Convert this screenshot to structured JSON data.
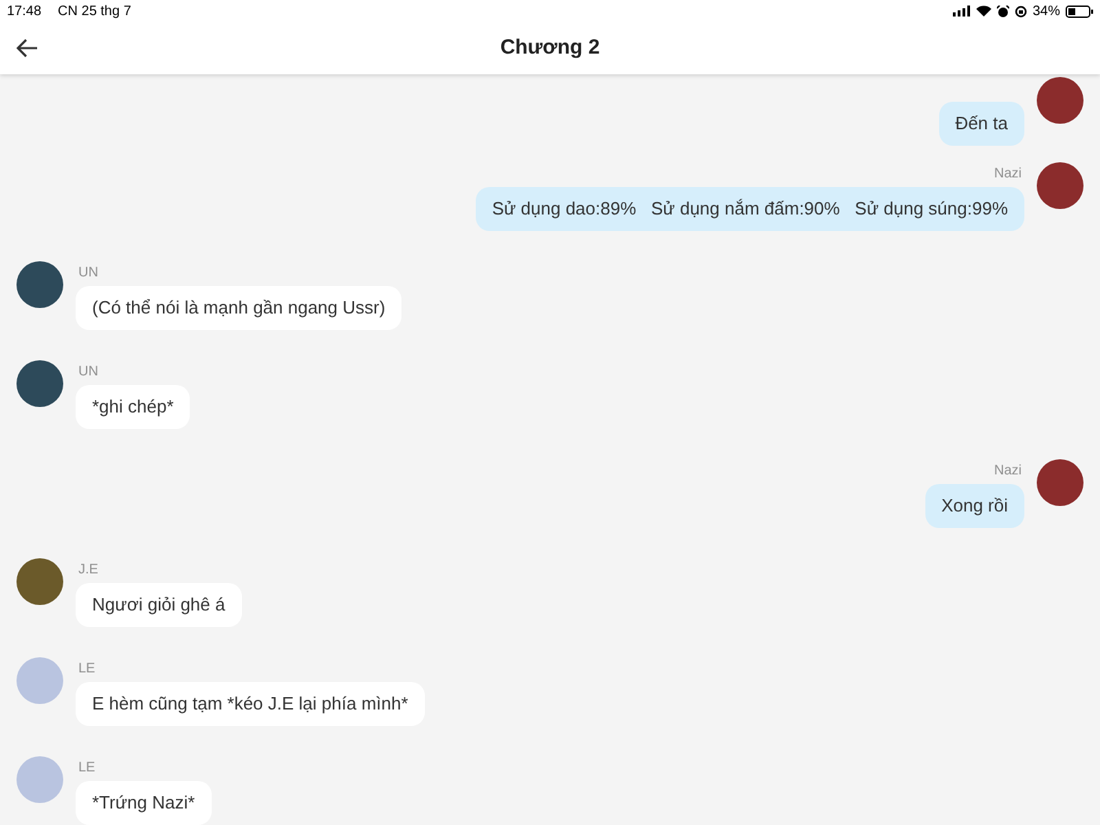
{
  "status_bar": {
    "time": "17:48",
    "date": "CN 25 thg 7",
    "battery": "34%"
  },
  "header": {
    "title": "Chương 2"
  },
  "messages": [
    {
      "kind": "sent",
      "text": "Đến ta",
      "color": "#8b2c2c"
    },
    {
      "kind": "sent",
      "sender": "Nazi",
      "text": "Sử dụng dao:89%   Sử dụng nắm đấm:90%   Sử dụng súng:99%",
      "color": "#8b2c2c"
    },
    {
      "kind": "received",
      "sender": "UN",
      "text": "(Có thể nói là mạnh gần ngang Ussr)",
      "color": "#2d4a5a"
    },
    {
      "kind": "received",
      "sender": "UN",
      "text": "*ghi chép*",
      "color": "#2d4a5a"
    },
    {
      "kind": "sent",
      "sender": "Nazi",
      "text": "Xong rồi",
      "color": "#8b2c2c"
    },
    {
      "kind": "received",
      "sender": "J.E",
      "text": "Ngươi giỏi ghê á",
      "color": "#6b5a2a"
    },
    {
      "kind": "received",
      "sender": "LE",
      "text": "E hèm cũng tạm *kéo J.E lại phía mình*",
      "color": "#b9c4e0"
    },
    {
      "kind": "received",
      "sender": "LE",
      "text": "*Trứng Nazi*",
      "color": "#b9c4e0"
    }
  ]
}
